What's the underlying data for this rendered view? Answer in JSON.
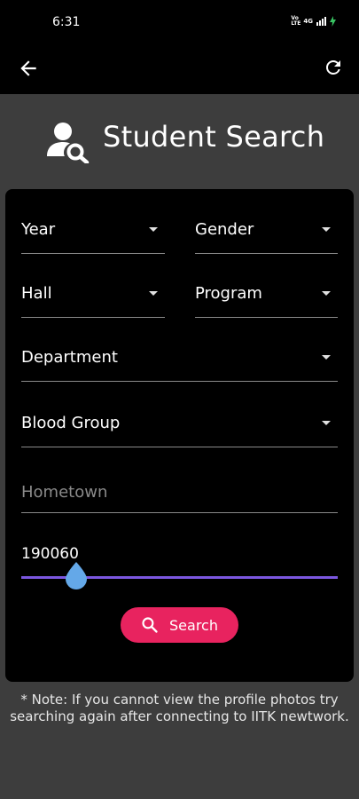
{
  "status_bar": {
    "time": "6:31",
    "volte": "Vo LTE",
    "network": "4G"
  },
  "app_bar": {
    "back_icon": "arrow-back-icon",
    "refresh_icon": "refresh-icon"
  },
  "header": {
    "icon": "person-search-icon",
    "title": "Student Search"
  },
  "filters": {
    "year": "Year",
    "gender": "Gender",
    "hall": "Hall",
    "program": "Program",
    "department": "Department",
    "blood_group": "Blood Group"
  },
  "hometown": {
    "placeholder": "Hometown",
    "value": ""
  },
  "slider": {
    "value": "190060",
    "fraction": 0.17
  },
  "search_button": {
    "label": "Search",
    "icon": "search-icon"
  },
  "note": "* Note: If you cannot view the profile photos try searching again after connecting to IITK newtwork.",
  "colors": {
    "accent": "#e8235f",
    "slider_track": "#7b57e0",
    "slider_thumb": "#64a8e8",
    "card_bg": "#000000",
    "page_bg": "#3d3d3d"
  }
}
